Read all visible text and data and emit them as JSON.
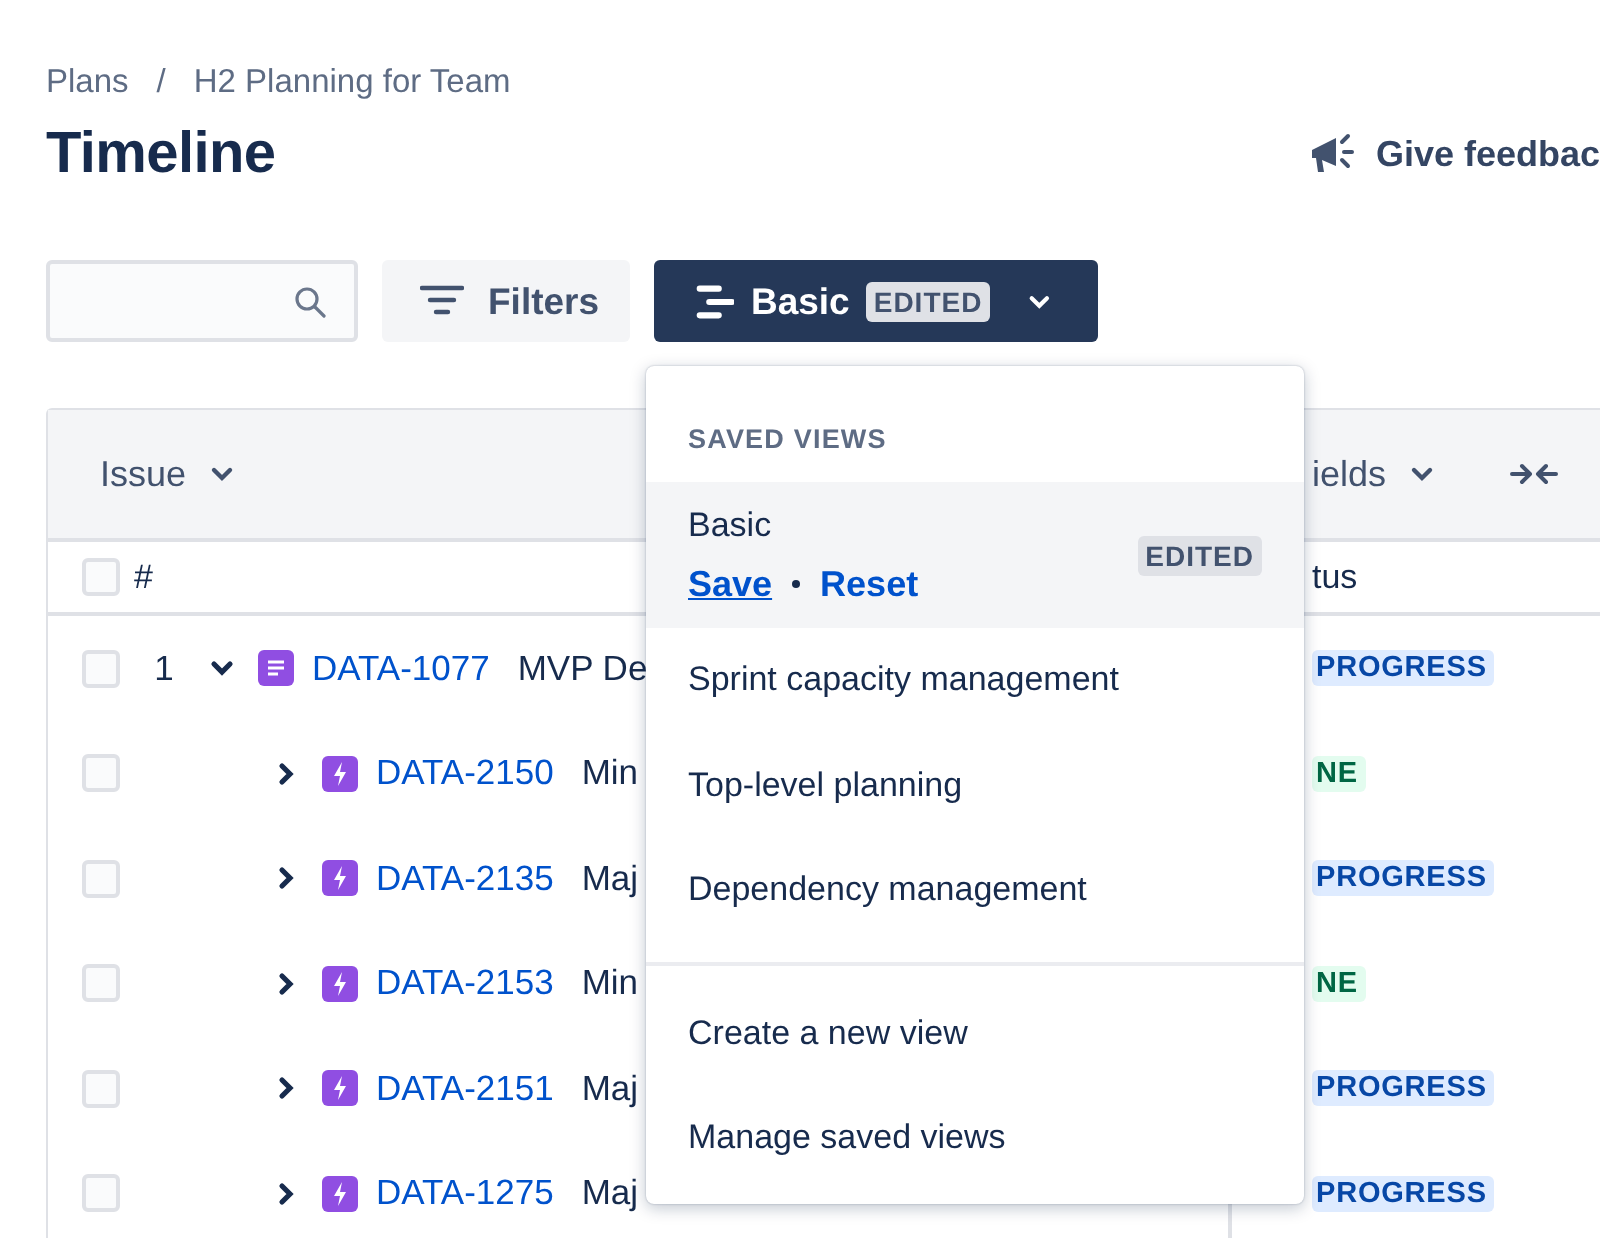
{
  "breadcrumbs": [
    "Plans",
    "H2 Planning for Team"
  ],
  "breadcrumb_separator": "/",
  "title": "Timeline",
  "feedback_button": "Give feedbac",
  "filters_button": "Filters",
  "view_button": {
    "label": "Basic",
    "badge": "EDITED"
  },
  "table": {
    "columns": [
      "Issue",
      "ields"
    ],
    "subheader": [
      "#",
      "tus"
    ],
    "select_all_checked": false,
    "rows": [
      {
        "number": "1",
        "checked": false,
        "expanded": true,
        "kind": "epic",
        "key": "DATA-1077",
        "summary": "MVP De",
        "status": {
          "text": "PROGRESS",
          "color": "#deebff"
        },
        "children": [
          {
            "checked": false,
            "expanded": false,
            "kind": "story",
            "key": "DATA-2150",
            "summary": "Min",
            "status": {
              "text": "NE",
              "color": "#e3fcef"
            }
          },
          {
            "checked": false,
            "expanded": false,
            "kind": "story",
            "key": "DATA-2135",
            "summary": "Maj",
            "status": {
              "text": "PROGRESS",
              "color": "#deebff"
            }
          },
          {
            "checked": false,
            "expanded": false,
            "kind": "story",
            "key": "DATA-2153",
            "summary": "Min",
            "status": {
              "text": "NE",
              "color": "#e3fcef"
            }
          },
          {
            "checked": false,
            "expanded": false,
            "kind": "story",
            "key": "DATA-2151",
            "summary": "Maj",
            "status": {
              "text": "PROGRESS",
              "color": "#deebff"
            }
          },
          {
            "checked": false,
            "expanded": false,
            "kind": "story",
            "key": "DATA-1275",
            "summary": "Maj",
            "status": {
              "text": "PROGRESS",
              "color": "#deebff"
            }
          }
        ]
      }
    ]
  },
  "menu": {
    "heading": "SAVED VIEWS",
    "views": [
      {
        "name": "Basic",
        "selected": true,
        "badge": "EDITED",
        "actions": [
          "Save",
          "Reset"
        ]
      },
      {
        "name": "Sprint capacity management",
        "selected": false
      },
      {
        "name": "Top-level planning",
        "selected": false
      },
      {
        "name": "Dependency management",
        "selected": false
      }
    ],
    "actions": [
      "Create a new view",
      "Manage saved views"
    ]
  }
}
